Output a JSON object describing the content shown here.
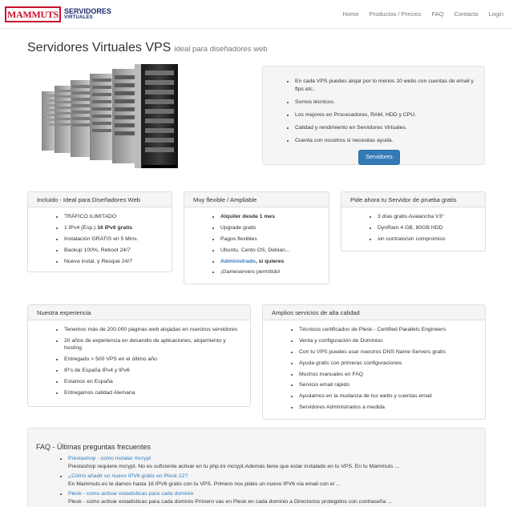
{
  "brand": {
    "logo_text": "MAMMUTS",
    "line1": "SERVIDORES",
    "line2": "VIRTUALES"
  },
  "nav": [
    {
      "label": "Home"
    },
    {
      "label": "Productos / Precios"
    },
    {
      "label": "FAQ"
    },
    {
      "label": "Contacto"
    },
    {
      "label": "Login"
    }
  ],
  "title": {
    "main": "Servidores Virtuales VPS",
    "sub": "ideal para diseñadores web"
  },
  "intro": {
    "items": [
      "En cada VPS puedes alojar por lo menos 10 webs con cuentas de email y ftps etc..",
      "Somos técnicos.",
      "Los mejores en Procesadores, RAM, HDD y CPU.",
      "Calidad y rendimiento en Servidores Virtuales.",
      "Cuenta con nosotros si necesitas ayuda."
    ],
    "button": "Servidores"
  },
  "panels": {
    "incluido": {
      "heading": "Incluido - Ideal para Diseñadores Web",
      "items": [
        {
          "text": "TRÁFICO ILIMITADO"
        },
        {
          "pre": "1 IPv4 (Esp.) ",
          "bold": "16 IPv6 gratis"
        },
        {
          "text": "Instalación GRATIS en 5 Mins."
        },
        {
          "text": "Backup 100%, Reboot 24/7"
        },
        {
          "text": "Nueva instal. y Resque 24/7"
        }
      ]
    },
    "flexible": {
      "heading": "Muy flexible / Ampliable",
      "items": [
        {
          "bold": "Alquiler desde 1 mes"
        },
        {
          "text": "Upgrade gratis"
        },
        {
          "text": "Pagos flexibles"
        },
        {
          "text": "Ubuntu, Cento OS, Debian..."
        },
        {
          "link": "Administrado",
          "bold_after": ", si quieres"
        },
        {
          "text": "¡Gameservers permitido!"
        }
      ]
    },
    "prueba": {
      "heading": "Pide ahora tu Servidor de prueba gratis",
      "items": [
        {
          "text": "3 días gratis Avalancha V3°"
        },
        {
          "text": "DynRam 4 GB, 80GB HDD"
        },
        {
          "text": "sin contrato/sin compromiso"
        }
      ]
    },
    "experiencia": {
      "heading": "Nuestra experiencia",
      "items": [
        "Tenemos más de 200.000 páginas web alojadas en nuestros servidores",
        "20 años de experiencia en desarollo de aplicaciones, alojamiento y hosting",
        "Entregado > 500 VPS en el último año",
        "IP's de España IPv4 y IPv6",
        "Estamos en España",
        "Entregamos calidad Alemana"
      ]
    },
    "servicios": {
      "heading": "Amplios servicios de alta calidad",
      "items": [
        "Técnicos certificados de Plesk - Certified Parallels Engineers",
        "Venta y configuración de Dominios",
        "Con tu VPS puedes usar nuestros DNS Name Servers gratis",
        "Ayuda gratis con primeras configuraciones",
        "Muchos manuales en FAQ",
        "Servicio email rápido",
        "Ayudamos en la mudanza de tus webs y cuentas email",
        "Servidores Administrados a medida"
      ]
    }
  },
  "faq": {
    "title": "FAQ - Últimas preguntas frecuentes",
    "items": [
      {
        "q": "Prestashop - como instalar mcrypt",
        "a": "Prestashop requiere mcrypt. No es suficiente activar en tu php.ini mcrypt.Además tiene que estar instalado en tu VPS. En tu Mammuts ..."
      },
      {
        "q": "¿Cómo añadir un nuevo IPV6 gratis en Plesk 12?",
        "a": "En Mammuts.es te damos hasta 16 IPV6 gratis con tu VPS. Primero nos pides un nuevo IPV6 vía email con el ..."
      },
      {
        "q": "Plesk - como activar estadisticas para cada dominio",
        "a": "Plesk - como activar estadisticas para cada dominio Primero vas en Plesk en cada dominio a  Directorios protegidos con contraseña ..."
      }
    ]
  },
  "colors": {
    "brand_red": "#c8102e",
    "brand_navy": "#1b2a6b",
    "link_blue": "#337ab7",
    "panel_bg": "#f5f5f5"
  }
}
